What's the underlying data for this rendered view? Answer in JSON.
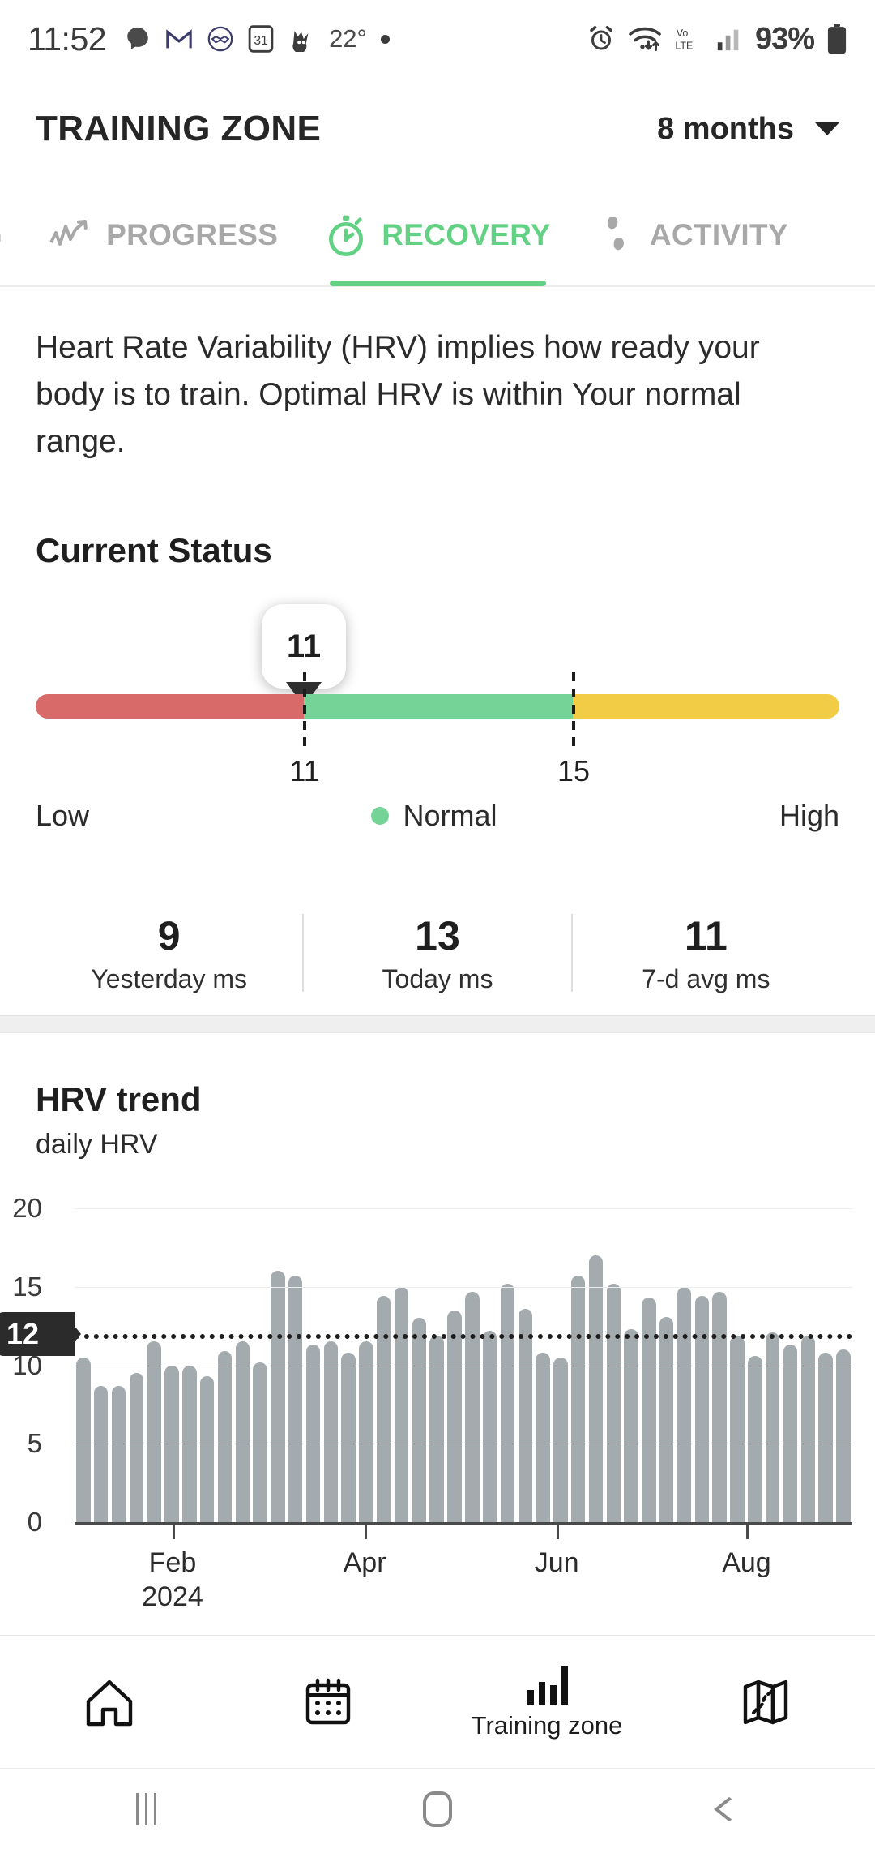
{
  "status_bar": {
    "time": "11:52",
    "temperature": "22°",
    "battery_percent": "93%",
    "network_label": "Vo\nLTE",
    "left_icons": [
      "chat-bubble-icon",
      "gmail-icon",
      "handshake-icon",
      "calendar-31-icon",
      "bird-icon"
    ],
    "right_icons": [
      "alarm-icon",
      "wifi-icon",
      "volte-icon",
      "signal-bars-icon",
      "battery-icon"
    ]
  },
  "header": {
    "title": "TRAINING ZONE",
    "range_label": "8 months"
  },
  "tabs": [
    {
      "label": "G",
      "icon": "partial-tab-icon",
      "active": false
    },
    {
      "label": "PROGRESS",
      "icon": "trend-arrow-icon",
      "active": false
    },
    {
      "label": "RECOVERY",
      "icon": "stopwatch-icon",
      "active": true
    },
    {
      "label": "ACTIVITY",
      "icon": "footsteps-icon",
      "active": false
    }
  ],
  "description": "Heart Rate Variability (HRV) implies how ready your body is to train. Optimal HRV is within Your normal range.",
  "current_status": {
    "heading": "Current Status",
    "marker_value": "11",
    "marker_percent": 33.4,
    "boundaries": [
      {
        "label": "11",
        "percent": 33.4
      },
      {
        "label": "15",
        "percent": 66.8
      }
    ],
    "segments": [
      {
        "name": "low",
        "color": "#d96a6a",
        "width_percent": 33.4
      },
      {
        "name": "normal",
        "color": "#76d398",
        "width_percent": 33.4
      },
      {
        "name": "high",
        "color": "#f3cc45",
        "width_percent": 33.2
      }
    ],
    "legend": {
      "low": "Low",
      "normal": "Normal",
      "high": "High",
      "normal_dot_color": "#76d398"
    },
    "stats": [
      {
        "value": "9",
        "label": "Yesterday ms"
      },
      {
        "value": "13",
        "label": "Today ms"
      },
      {
        "value": "11",
        "label": "7-d avg ms"
      }
    ]
  },
  "chart_section": {
    "title": "HRV trend",
    "subtitle": "daily HRV"
  },
  "chart_data": {
    "type": "bar",
    "title": "HRV trend",
    "subtitle": "daily HRV",
    "xlabel": "",
    "ylabel": "",
    "ylim": [
      0,
      20
    ],
    "yticks": [
      0,
      5,
      10,
      15,
      20
    ],
    "grid": true,
    "bar_color": "#a3abae",
    "reference_line": {
      "value": 12,
      "label": "12",
      "style": "dotted",
      "color": "#1d1d1d"
    },
    "x_tick_labels": [
      {
        "label": "Feb",
        "sublabel": "2024",
        "percent": 12.6
      },
      {
        "label": "Apr",
        "sublabel": "",
        "percent": 37.3
      },
      {
        "label": "Jun",
        "sublabel": "",
        "percent": 62.0
      },
      {
        "label": "Aug",
        "sublabel": "",
        "percent": 86.4
      }
    ],
    "values": [
      10.5,
      8.7,
      8.7,
      9.5,
      11.5,
      10.0,
      10.0,
      9.3,
      10.9,
      11.5,
      10.2,
      16.0,
      15.7,
      11.3,
      11.5,
      10.8,
      11.5,
      14.4,
      15.0,
      13.0,
      11.9,
      13.5,
      14.7,
      12.2,
      15.2,
      13.6,
      10.8,
      10.5,
      15.7,
      17.0,
      15.2,
      12.3,
      14.3,
      13.1,
      15.0,
      14.4,
      14.7,
      11.9,
      10.6,
      12.1,
      11.3,
      11.9,
      10.8,
      11.0
    ]
  },
  "bottom_nav": [
    {
      "icon": "home-icon",
      "label": "",
      "active": false
    },
    {
      "icon": "calendar-icon",
      "label": "",
      "active": false
    },
    {
      "icon": "bar-chart-icon",
      "label": "Training zone",
      "active": true
    },
    {
      "icon": "map-icon",
      "label": "",
      "active": false
    }
  ],
  "system_nav": [
    {
      "icon": "recents-icon"
    },
    {
      "icon": "home-square-icon"
    },
    {
      "icon": "back-chevron-icon"
    }
  ]
}
